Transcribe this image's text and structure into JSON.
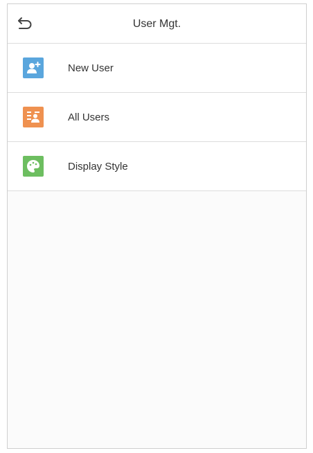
{
  "header": {
    "title": "User Mgt.",
    "back_icon": "back-arrow-icon"
  },
  "menu": {
    "items": [
      {
        "label": "New User",
        "icon": "add-user-icon",
        "color": "#5aa6dd"
      },
      {
        "label": "All Users",
        "icon": "user-list-icon",
        "color": "#ef9150"
      },
      {
        "label": "Display Style",
        "icon": "palette-icon",
        "color": "#6dbe60"
      }
    ]
  },
  "colors": {
    "background": "#fbfbfb",
    "divider": "#dcdcdc",
    "text": "#333333"
  }
}
